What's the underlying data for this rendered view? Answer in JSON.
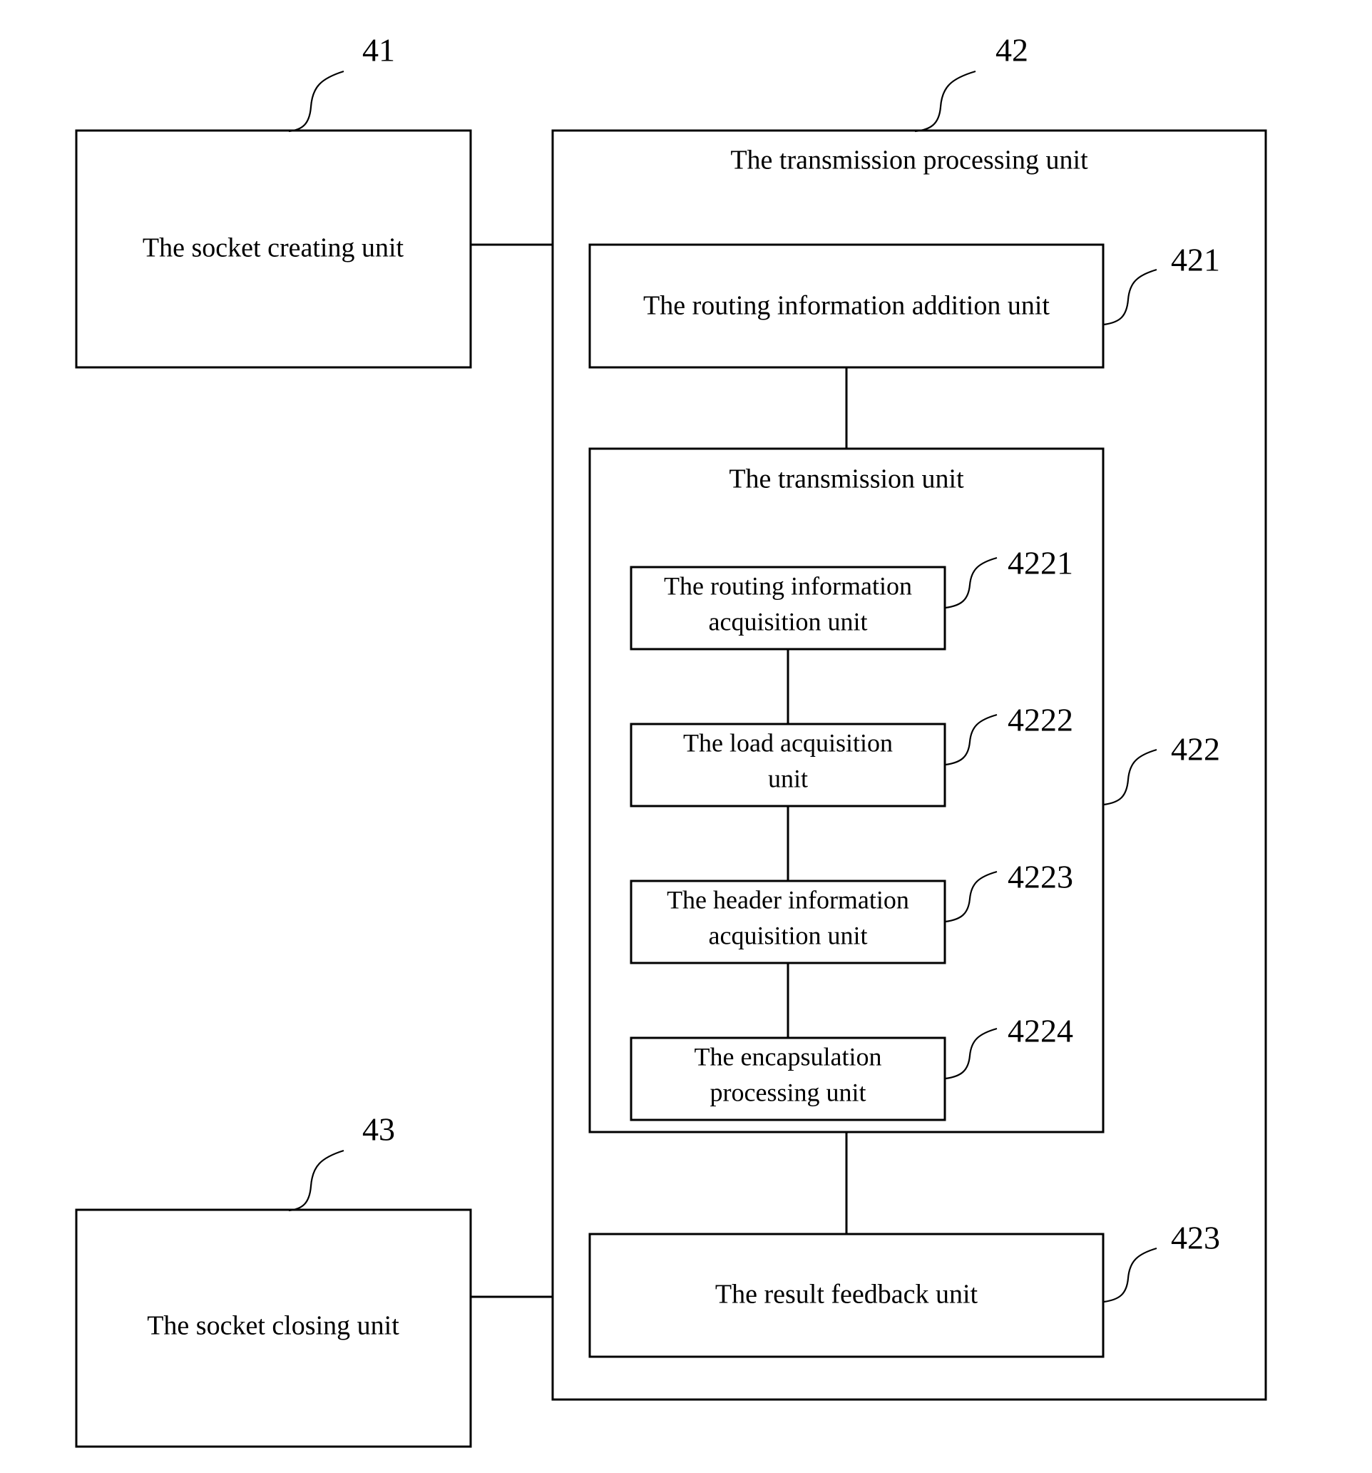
{
  "figure": {
    "type": "patent-block-diagram",
    "background_color": "#ffffff",
    "line_color": "#000000",
    "text_color": "#000000"
  },
  "blocks": {
    "socket_creating_unit": {
      "label": "The socket creating unit",
      "ref": "41"
    },
    "transmission_processing_unit": {
      "label": "The transmission processing unit",
      "ref": "42"
    },
    "routing_information_addition_unit": {
      "label": "The routing information addition unit",
      "ref": "421"
    },
    "transmission_unit": {
      "label": "The transmission unit",
      "ref": "422"
    },
    "routing_information_acquisition_unit": {
      "line1": "The routing information",
      "line2": "acquisition unit",
      "ref": "4221"
    },
    "load_acquisition_unit": {
      "line1": "The load acquisition",
      "line2": "unit",
      "ref": "4222"
    },
    "header_information_acquisition_unit": {
      "line1": "The header information",
      "line2": "acquisition unit",
      "ref": "4223"
    },
    "encapsulation_processing_unit": {
      "line1": "The encapsulation",
      "line2": "processing unit",
      "ref": "4224"
    },
    "result_feedback_unit": {
      "label": "The result feedback unit",
      "ref": "423"
    },
    "socket_closing_unit": {
      "label": "The socket closing unit",
      "ref": "43"
    }
  }
}
